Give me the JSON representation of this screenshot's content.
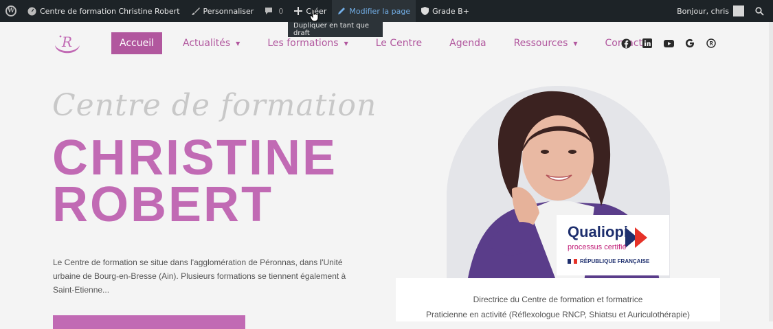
{
  "adminbar": {
    "site_name": "Centre de formation Christine Robert",
    "customize": "Personnaliser",
    "comments_count": "0",
    "new": "Créer",
    "edit_page": "Modifier la page",
    "grade": "Grade B+",
    "greeting": "Bonjour, chris",
    "dropdown_item": "Dupliquer en tant que draft"
  },
  "nav": {
    "items": [
      {
        "label": "Accueil"
      },
      {
        "label": "Actualités",
        "caret": "▼"
      },
      {
        "label": "Les formations",
        "caret": "▼"
      },
      {
        "label": "Le Centre"
      },
      {
        "label": "Agenda"
      },
      {
        "label": "Ressources",
        "caret": "▼"
      },
      {
        "label": "Contact"
      }
    ],
    "socials": [
      "facebook-icon",
      "linkedin-icon",
      "youtube-icon",
      "google-icon",
      "registered-icon"
    ]
  },
  "hero": {
    "script_title": "Centre de formation",
    "name_line1": "CHRISTINE",
    "name_line2": "ROBERT",
    "description": "Le Centre de formation se situe dans l'agglomération de Péronnas, dans l'Unité urbaine de Bourg-en-Bresse (Ain). Plusieurs formations se tiennent également à Saint-Etienne..."
  },
  "badge": {
    "title": "Qualiopi",
    "subtitle": "processus certifié",
    "republic": "RÉPUBLIQUE FRANÇAISE"
  },
  "card": {
    "line1": "Directrice du Centre de formation et formatrice",
    "line2": "Praticienne en activité (Réflexologue RNCP, Shiatsu et Auriculothérapie)"
  },
  "colors": {
    "accent": "#b1579e",
    "title_pink": "#c16ab4",
    "adminbar_bg": "#1d2327",
    "qualiopi_blue": "#1e2f6e",
    "qualiopi_red": "#e63228"
  }
}
